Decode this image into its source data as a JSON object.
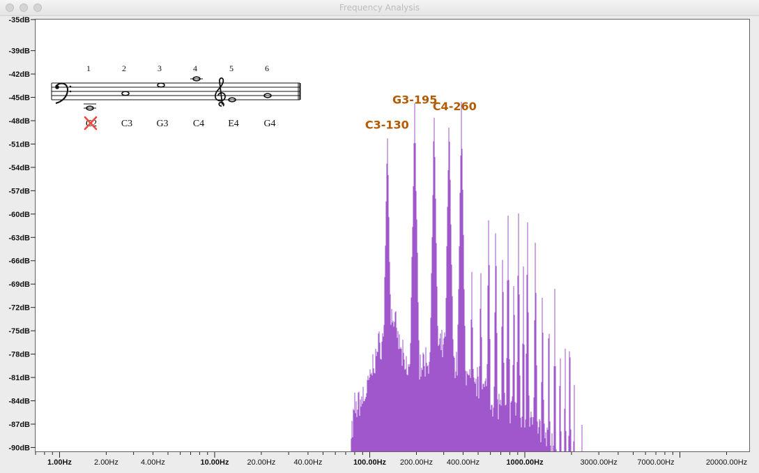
{
  "window": {
    "title": "Frequency Analysis"
  },
  "score": {
    "numbers": [
      "1",
      "2",
      "3",
      "4",
      "5",
      "6"
    ],
    "notes": [
      "C2",
      "C3",
      "G3",
      "C4",
      "E4",
      "G4"
    ],
    "struck_note": "C2"
  },
  "chart_data": {
    "type": "area",
    "xscale": "log",
    "yunit": "dB",
    "xlim": [
      0.7,
      28000
    ],
    "ylim": [
      -90.5,
      -35
    ],
    "ytick_labels": [
      "-35dB",
      "-39dB",
      "-42dB",
      "-45dB",
      "-48dB",
      "-51dB",
      "-54dB",
      "-57dB",
      "-60dB",
      "-63dB",
      "-66dB",
      "-69dB",
      "-72dB",
      "-75dB",
      "-78dB",
      "-81dB",
      "-84dB",
      "-87dB",
      "-90dB"
    ],
    "ytick_values": [
      -35,
      -39,
      -42,
      -45,
      -48,
      -51,
      -54,
      -57,
      -60,
      -63,
      -66,
      -69,
      -72,
      -75,
      -78,
      -81,
      -84,
      -87,
      -90
    ],
    "bold_yticks": [
      "-35dB",
      "-48dB",
      "-72dB",
      "-84dB",
      "-90dB"
    ],
    "xtick_labels": [
      "1.00Hz",
      "2.00Hz",
      "4.00Hz",
      "10.00Hz",
      "20.00Hz",
      "40.00Hz",
      "100.00Hz",
      "200.00Hz",
      "400.00Hz",
      "1000.00Hz",
      "3000.00Hz",
      "7000.00Hz",
      "20000.00Hz"
    ],
    "xtick_values": [
      1,
      2,
      4,
      10,
      20,
      40,
      100,
      200,
      400,
      1000,
      3000,
      7000,
      20000
    ],
    "bold_xticks": [
      "1.00Hz",
      "10.00Hz",
      "100.00Hz",
      "1000.00Hz"
    ],
    "color": "#a057cc",
    "peaks": [
      {
        "hz": 65,
        "db": -88.5,
        "w": 0.015
      },
      {
        "hz": 130,
        "db": -50.3,
        "w": 0.013
      },
      {
        "hz": 195,
        "db": -46.5,
        "w": 0.013
      },
      {
        "hz": 260,
        "db": -47.2,
        "w": 0.012
      },
      {
        "hz": 325,
        "db": -47.0,
        "w": 0.012
      },
      {
        "hz": 390,
        "db": -46.0,
        "w": 0.011
      },
      {
        "hz": 455,
        "db": -66.5,
        "w": 0.008
      },
      {
        "hz": 520,
        "db": -65.5,
        "w": 0.008
      },
      {
        "hz": 585,
        "db": -59.0,
        "w": 0.007
      },
      {
        "hz": 650,
        "db": -60.0,
        "w": 0.007
      },
      {
        "hz": 720,
        "db": -64.0,
        "w": 0.007
      },
      {
        "hz": 780,
        "db": -60.0,
        "w": 0.007
      },
      {
        "hz": 850,
        "db": -66.0,
        "w": 0.006
      },
      {
        "hz": 910,
        "db": -58.8,
        "w": 0.006
      },
      {
        "hz": 980,
        "db": -66.0,
        "w": 0.006
      },
      {
        "hz": 1040,
        "db": -59.5,
        "w": 0.006
      },
      {
        "hz": 1170,
        "db": -61.0,
        "w": 0.006
      },
      {
        "hz": 1300,
        "db": -67.5,
        "w": 0.006
      },
      {
        "hz": 1430,
        "db": -71.0,
        "w": 0.006
      },
      {
        "hz": 1560,
        "db": -69.0,
        "w": 0.006
      },
      {
        "hz": 1690,
        "db": -75.0,
        "w": 0.006
      },
      {
        "hz": 1820,
        "db": -76.5,
        "w": 0.006
      },
      {
        "hz": 1950,
        "db": -72.5,
        "w": 0.006
      },
      {
        "hz": 2080,
        "db": -80.5,
        "w": 0.006
      },
      {
        "hz": 2340,
        "db": -85.5,
        "w": 0.006
      },
      {
        "hz": 2600,
        "db": -88.5,
        "w": 0.006
      }
    ],
    "floor": [
      {
        "hz": 75,
        "db": -90.5
      },
      {
        "hz": 80,
        "db": -85
      },
      {
        "hz": 95,
        "db": -83
      },
      {
        "hz": 110,
        "db": -78
      },
      {
        "hz": 140,
        "db": -73
      },
      {
        "hz": 170,
        "db": -80
      },
      {
        "hz": 230,
        "db": -79
      },
      {
        "hz": 300,
        "db": -77
      },
      {
        "hz": 360,
        "db": -79
      },
      {
        "hz": 430,
        "db": -81
      },
      {
        "hz": 520,
        "db": -82
      },
      {
        "hz": 620,
        "db": -84
      },
      {
        "hz": 800,
        "db": -85
      },
      {
        "hz": 1000,
        "db": -86
      },
      {
        "hz": 1300,
        "db": -88
      },
      {
        "hz": 1600,
        "db": -90.5
      }
    ],
    "annotations": [
      {
        "text": "C3-130",
        "hz": 130
      },
      {
        "text": "G3-195",
        "hz": 195
      },
      {
        "text": "C4-260",
        "hz": 260
      }
    ]
  }
}
